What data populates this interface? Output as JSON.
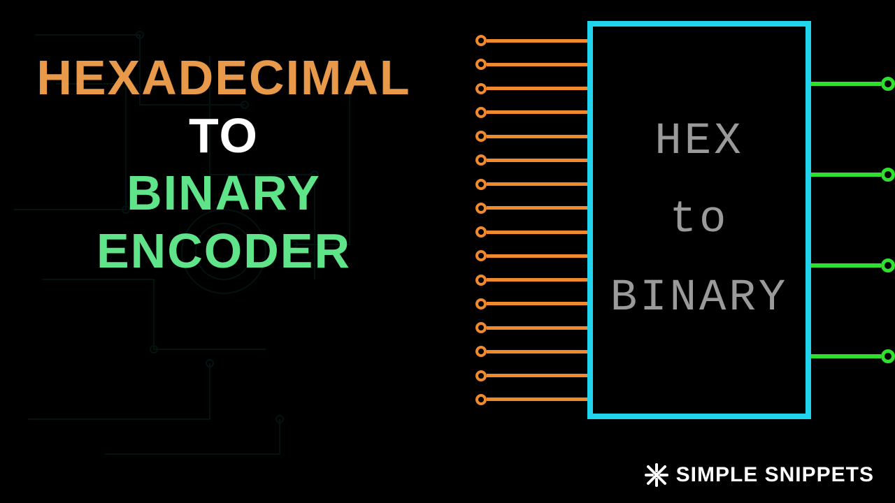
{
  "title": {
    "line1": "HEXADECIMAL",
    "line2": "TO",
    "line3": "BINARY",
    "line4": "ENCODER"
  },
  "chip": {
    "line1": "HEX",
    "line2": "to",
    "line3": "BINARY"
  },
  "diagram": {
    "input_count": 16,
    "output_count": 4,
    "input_color": "#f08a2c",
    "output_color": "#2fe02f",
    "chip_border_color": "#22d3ee"
  },
  "brand": {
    "name": "SIMPLE SNIPPETS",
    "icon": "cross-star-icon"
  }
}
